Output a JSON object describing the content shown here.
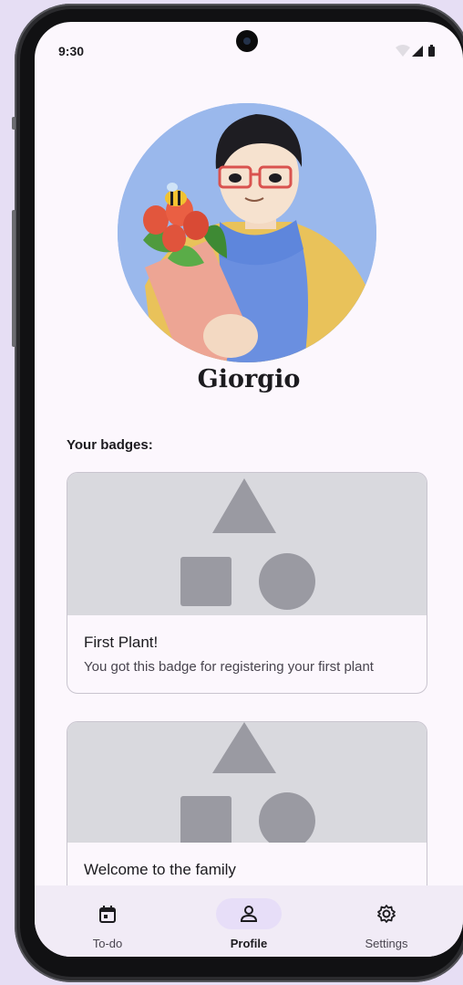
{
  "status_bar": {
    "time": "9:30",
    "icons": [
      "wifi-icon",
      "signal-icon",
      "battery-icon"
    ]
  },
  "profile": {
    "name": "Giorgio",
    "avatar": "avatar-illustration"
  },
  "badges": {
    "heading": "Your badges:",
    "items": [
      {
        "title": "First Plant!",
        "description": "You got this badge for registering your first plant",
        "image": "badge-placeholder-shapes"
      },
      {
        "title": "Welcome to the family",
        "description": "",
        "image": "badge-placeholder-shapes"
      }
    ]
  },
  "nav": {
    "items": [
      {
        "label": "To-do",
        "icon": "calendar-icon",
        "active": false
      },
      {
        "label": "Profile",
        "icon": "person-icon",
        "active": true
      },
      {
        "label": "Settings",
        "icon": "gear-icon",
        "active": false
      }
    ]
  },
  "colors": {
    "background": "#fcf7fd",
    "nav_background": "#f1ebf6",
    "active_pill": "#e7def8",
    "placeholder_bg": "#d9d9de",
    "placeholder_shape": "#9a9aa2",
    "avatar_bg": "#9ab8ec"
  }
}
